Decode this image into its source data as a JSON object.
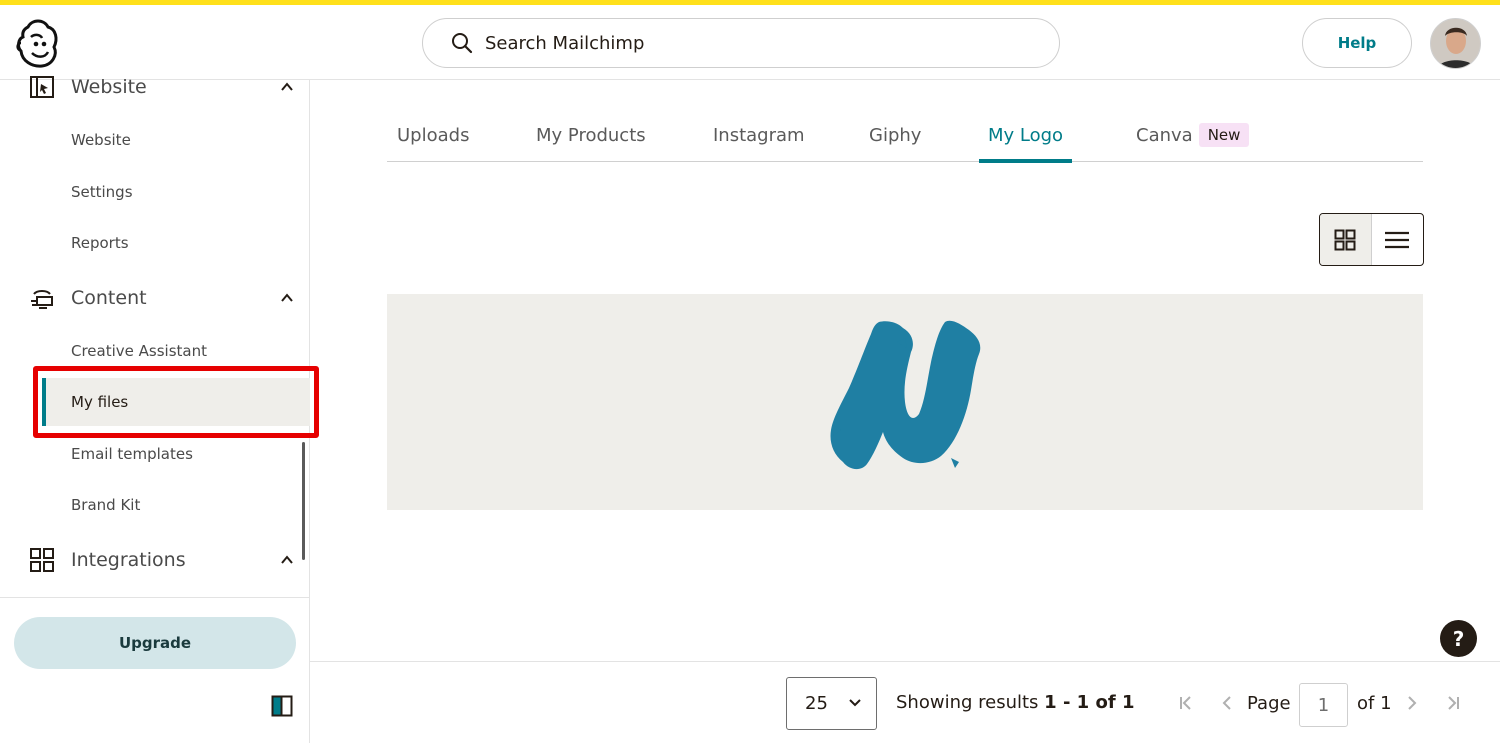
{
  "header": {
    "search_placeholder": "Search Mailchimp",
    "help_label": "Help"
  },
  "sidebar": {
    "sections": [
      {
        "label": "Website",
        "icon": "website-icon",
        "items": [
          "Website",
          "Settings",
          "Reports"
        ]
      },
      {
        "label": "Content",
        "icon": "content-icon",
        "items": [
          "Creative Assistant",
          "My files",
          "Email templates",
          "Brand Kit"
        ]
      },
      {
        "label": "Integrations",
        "icon": "integrations-icon",
        "items": []
      }
    ],
    "active_item": "My files",
    "upgrade_label": "Upgrade"
  },
  "tabs": [
    {
      "label": "Uploads"
    },
    {
      "label": "My Products"
    },
    {
      "label": "Instagram"
    },
    {
      "label": "Giphy"
    },
    {
      "label": "My Logo",
      "active": true
    },
    {
      "label": "Canva",
      "badge": "New"
    }
  ],
  "view": {
    "selected": "grid"
  },
  "footer": {
    "per_page": "25",
    "results_prefix": "Showing results ",
    "results_range": "1 - 1 of 1",
    "page_label": "Page",
    "page_value": "1",
    "page_of": "of 1"
  },
  "help_fab": "?",
  "colors": {
    "accent_yellow": "#ffe01b",
    "teal": "#007c89",
    "logo_blue": "#1f7fa3",
    "highlight_red": "#e60000",
    "badge_pink": "#f7e1f5",
    "preview_bg": "#efeeea"
  }
}
